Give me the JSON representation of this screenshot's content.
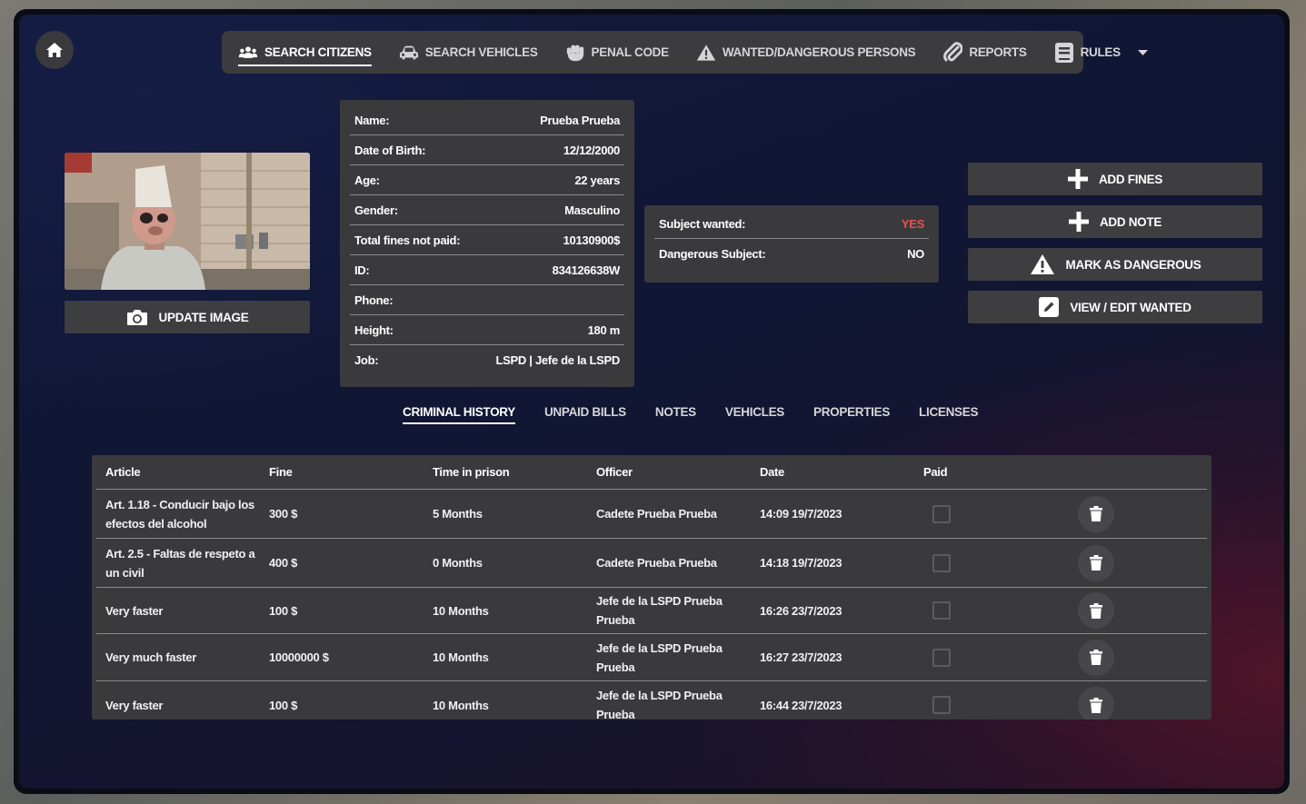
{
  "nav": {
    "items": [
      {
        "label": "SEARCH CITIZENS",
        "icon": "users-icon",
        "active": true
      },
      {
        "label": "SEARCH VEHICLES",
        "icon": "car-icon",
        "active": false
      },
      {
        "label": "PENAL CODE",
        "icon": "fist-icon",
        "active": false
      },
      {
        "label": "WANTED/DANGEROUS PERSONS",
        "icon": "warning-icon",
        "active": false
      },
      {
        "label": "REPORTS",
        "icon": "paperclip-icon",
        "active": false
      },
      {
        "label": "RULES",
        "icon": "book-icon",
        "active": false
      }
    ]
  },
  "photo": {
    "update_label": "UPDATE IMAGE"
  },
  "citizen": {
    "rows": [
      {
        "label": "Name:",
        "value": "Prueba Prueba"
      },
      {
        "label": "Date of Birth:",
        "value": "12/12/2000"
      },
      {
        "label": "Age:",
        "value": "22 years"
      },
      {
        "label": "Gender:",
        "value": "Masculino"
      },
      {
        "label": "Total fines not paid:",
        "value": "10130900$"
      },
      {
        "label": "ID:",
        "value": "834126638W"
      },
      {
        "label": "Phone:",
        "value": ""
      },
      {
        "label": "Height:",
        "value": "180 m"
      },
      {
        "label": "Job:",
        "value": "LSPD | Jefe de la LSPD"
      }
    ]
  },
  "status": {
    "wanted_label": "Subject wanted:",
    "wanted_value": "YES",
    "dangerous_label": "Dangerous Subject:",
    "dangerous_value": "NO"
  },
  "actions": {
    "add_fines": "ADD FINES",
    "add_note": "ADD NOTE",
    "mark_dangerous": "MARK AS DANGEROUS",
    "view_edit_wanted": "VIEW / EDIT WANTED"
  },
  "tabs": [
    "CRIMINAL HISTORY",
    "UNPAID BILLS",
    "NOTES",
    "VEHICLES",
    "PROPERTIES",
    "LICENSES"
  ],
  "table": {
    "headers": [
      "Article",
      "Fine",
      "Time in prison",
      "Officer",
      "Date",
      "Paid"
    ],
    "rows": [
      {
        "article": "Art. 1.18 - Conducir bajo los efectos del alcohol",
        "fine": "300 $",
        "time": "5 Months",
        "officer": "Cadete Prueba Prueba",
        "date": "14:09 19/7/2023"
      },
      {
        "article": "Art. 2.5 - Faltas de respeto a un civil",
        "fine": "400 $",
        "time": "0 Months",
        "officer": "Cadete Prueba Prueba",
        "date": "14:18 19/7/2023"
      },
      {
        "article": "Very faster",
        "fine": "100 $",
        "time": "10 Months",
        "officer": "Jefe de la LSPD Prueba Prueba",
        "date": "16:26 23/7/2023"
      },
      {
        "article": "Very much faster",
        "fine": "10000000 $",
        "time": "10 Months",
        "officer": "Jefe de la LSPD Prueba Prueba",
        "date": "16:27 23/7/2023"
      },
      {
        "article": "Very faster",
        "fine": "100 $",
        "time": "10 Months",
        "officer": "Jefe de la LSPD Prueba Prueba",
        "date": "16:44 23/7/2023"
      }
    ]
  },
  "colors": {
    "wanted_yes": "#e25454",
    "panel": "#3a3a3d",
    "button": "#3e3e41"
  }
}
